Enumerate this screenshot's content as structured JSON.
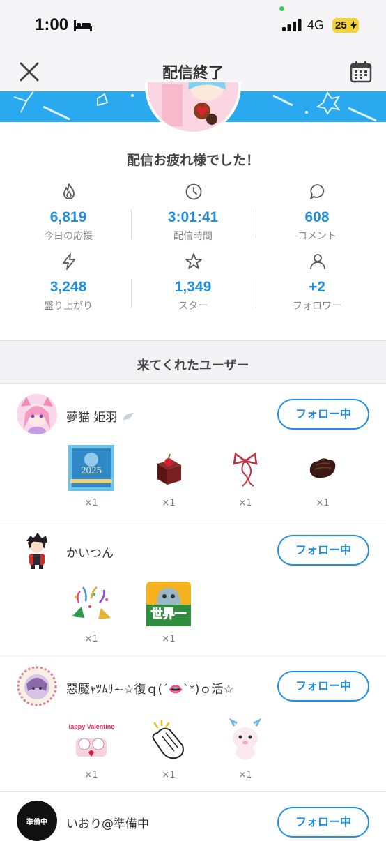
{
  "status_bar": {
    "time": "1:00",
    "network": "4G",
    "battery": "25"
  },
  "nav": {
    "title": "配信終了"
  },
  "summary": {
    "message": "配信お疲れ様でした！"
  },
  "stats": [
    {
      "icon": "flame-icon",
      "value": "6,819",
      "label": "今日の応援"
    },
    {
      "icon": "clock-icon",
      "value": "3:01:41",
      "label": "配信時間"
    },
    {
      "icon": "comment-icon",
      "value": "608",
      "label": "コメント"
    },
    {
      "icon": "lightning-icon",
      "value": "3,248",
      "label": "盛り上がり"
    },
    {
      "icon": "star-icon",
      "value": "1,349",
      "label": "スター"
    },
    {
      "icon": "person-icon",
      "value": "+2",
      "label": "フォロワー"
    }
  ],
  "visitors": {
    "title": "来てくれたユーザー",
    "follow_label": "フォロー中",
    "users": [
      {
        "name": "夢猫 姫羽",
        "gifts": [
          {
            "icon": "2025-card-icon",
            "count": "×1",
            "text": "2025"
          },
          {
            "icon": "chocolate-box-icon",
            "count": "×1"
          },
          {
            "icon": "ribbon-icon",
            "count": "×1"
          },
          {
            "icon": "chocolate-icon",
            "count": "×1"
          }
        ]
      },
      {
        "name": "かいつん",
        "gifts": [
          {
            "icon": "party-popper-icon",
            "count": "×1"
          },
          {
            "icon": "sekai-ichi-stamp-icon",
            "count": "×1",
            "text": "世界一"
          }
        ]
      },
      {
        "name": "惡魘ｬﾂﾑﾘ~☆復ｑ(´👄`*)ｏ活☆",
        "gifts": [
          {
            "icon": "happy-valentine-icon",
            "count": "×1",
            "text": "Happy Valentine!"
          },
          {
            "icon": "clapping-hands-icon",
            "count": "×1"
          },
          {
            "icon": "dragon-mascot-icon",
            "count": "×1"
          }
        ]
      },
      {
        "name": "いおり@準備中",
        "avatar_text": "準備中",
        "gifts": []
      }
    ]
  }
}
